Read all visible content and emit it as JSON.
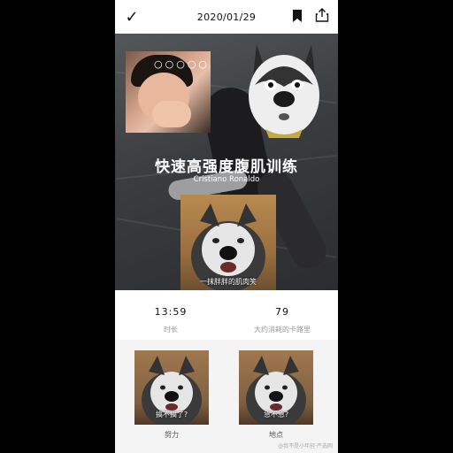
{
  "topbar": {
    "check_icon": "checkmark-icon",
    "date": "2020/01/29",
    "bookmark_icon": "bookmark-icon",
    "share_icon": "share-icon"
  },
  "hero": {
    "overlay_dots": "○○○○○",
    "title": "快速高强度腹肌训练",
    "subtitle": "Cristiano Ronaldo",
    "dog_caption": "一抹胖胖的肌肉笑"
  },
  "stats": [
    {
      "value": "13:59",
      "label": "时长"
    },
    {
      "value": "79",
      "label": "大约消耗的卡路里"
    }
  ],
  "cards": [
    {
      "caption": "搞不搞了?",
      "label": "努力"
    },
    {
      "caption": "急不急?",
      "label": "地点"
    }
  ],
  "watermark": "@我不是小年轻·严选网"
}
